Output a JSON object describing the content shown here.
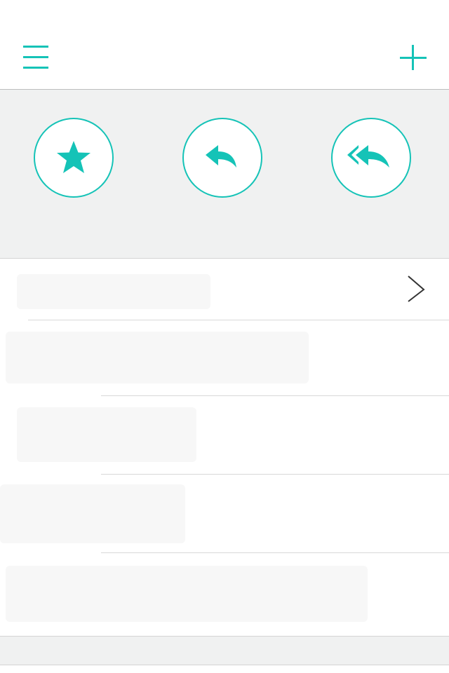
{
  "topbar": {
    "menu_icon": "hamburger-menu-icon",
    "add_icon": "plus-icon"
  },
  "actions": [
    {
      "name": "star",
      "icon": "star-icon"
    },
    {
      "name": "reply",
      "icon": "reply-icon"
    },
    {
      "name": "reply-all",
      "icon": "reply-all-icon"
    }
  ],
  "list": {
    "rows": [
      {
        "label": ""
      },
      {
        "label": ""
      },
      {
        "label": ""
      },
      {
        "label": ""
      },
      {
        "label": ""
      }
    ]
  },
  "colors": {
    "accent": "#15c3b7",
    "panel_bg": "#f0f1f1",
    "divider": "#d8d8d8",
    "chevron": "#333333"
  }
}
